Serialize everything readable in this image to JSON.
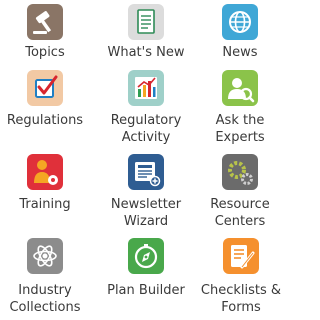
{
  "tiles": [
    {
      "label_lines": [
        "Topics"
      ],
      "icon": "gavel-icon",
      "color": "#8a7566"
    },
    {
      "label_lines": [
        "What's New"
      ],
      "icon": "document-icon",
      "color": "#dcdcdc"
    },
    {
      "label_lines": [
        "News"
      ],
      "icon": "globe-icon",
      "color": "#3fa7d6"
    },
    {
      "label_lines": [
        "Regulations"
      ],
      "icon": "checkbox-icon",
      "color": "#f2c9a4"
    },
    {
      "label_lines": [
        "Regulatory",
        "Activity"
      ],
      "icon": "bar-chart-icon",
      "color": "#9fd0c9"
    },
    {
      "label_lines": [
        "Ask the",
        "Experts"
      ],
      "icon": "expert-search-icon",
      "color": "#8bc34a"
    },
    {
      "label_lines": [
        "Training"
      ],
      "icon": "trainee-gear-icon",
      "color": "#e0303a"
    },
    {
      "label_lines": [
        "Newsletter",
        "Wizard"
      ],
      "icon": "newsletter-icon",
      "color": "#2f5d92"
    },
    {
      "label_lines": [
        "Resource",
        "Centers"
      ],
      "icon": "gears-icon",
      "color": "#6b6b6b"
    },
    {
      "label_lines": [
        "Industry",
        "Collections"
      ],
      "icon": "atom-icon",
      "color": "#8c8c8c"
    },
    {
      "label_lines": [
        "Plan Builder"
      ],
      "icon": "compass-icon",
      "color": "#49a84b"
    },
    {
      "label_lines": [
        "Checklists &",
        "Forms"
      ],
      "icon": "checklist-edit-icon",
      "color": "#f5902e"
    }
  ]
}
